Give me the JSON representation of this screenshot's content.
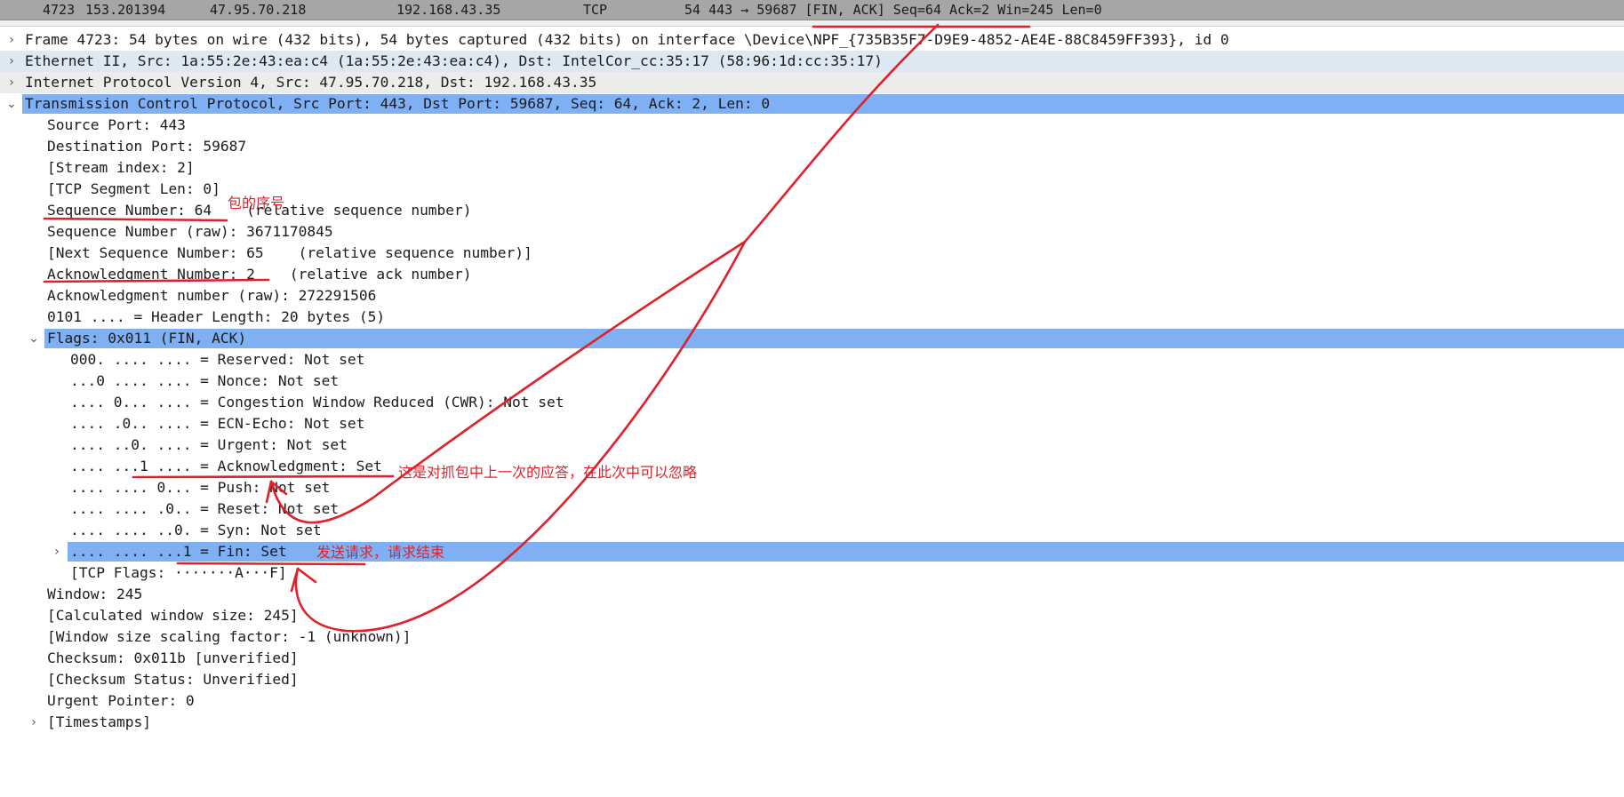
{
  "packet_row": {
    "no": "4723",
    "time": "153.201394",
    "source": "47.95.70.218",
    "destination": "192.168.43.35",
    "protocol": "TCP",
    "info": "54 443 → 59687 [FIN, ACK] Seq=64 Ack=2 Win=245 Len=0"
  },
  "details": [
    {
      "text": "Frame 4723: 54 bytes on wire (432 bits), 54 bytes captured (432 bits) on interface \\Device\\NPF_{735B35F7-D9E9-4852-AE4E-88C8459FF393}, id 0",
      "arrow": "›"
    },
    {
      "text": "Ethernet II, Src: 1a:55:2e:43:ea:c4 (1a:55:2e:43:ea:c4), Dst: IntelCor_cc:35:17 (58:96:1d:cc:35:17)",
      "arrow": "›"
    },
    {
      "text": "Internet Protocol Version 4, Src: 47.95.70.218, Dst: 192.168.43.35",
      "arrow": "›"
    },
    {
      "text": "Transmission Control Protocol, Src Port: 443, Dst Port: 59687, Seq: 64, Ack: 2, Len: 0",
      "arrow": "⌄"
    },
    {
      "text": "Source Port: 443"
    },
    {
      "text": "Destination Port: 59687"
    },
    {
      "text": "[Stream index: 2]"
    },
    {
      "text": "[TCP Segment Len: 0]"
    },
    {
      "text": "Sequence Number: 64    (relative sequence number)"
    },
    {
      "text": "Sequence Number (raw): 3671170845"
    },
    {
      "text": "[Next Sequence Number: 65    (relative sequence number)]"
    },
    {
      "text": "Acknowledgment Number: 2    (relative ack number)"
    },
    {
      "text": "Acknowledgment number (raw): 272291506"
    },
    {
      "text": "0101 .... = Header Length: 20 bytes (5)"
    },
    {
      "text": "Flags: 0x011 (FIN, ACK)",
      "arrow": "⌄"
    },
    {
      "text": "000. .... .... = Reserved: Not set"
    },
    {
      "text": "...0 .... .... = Nonce: Not set"
    },
    {
      "text": ".... 0... .... = Congestion Window Reduced (CWR): Not set"
    },
    {
      "text": ".... .0.. .... = ECN-Echo: Not set"
    },
    {
      "text": ".... ..0. .... = Urgent: Not set"
    },
    {
      "text": ".... ...1 .... = Acknowledgment: Set"
    },
    {
      "text": ".... .... 0... = Push: Not set"
    },
    {
      "text": ".... .... .0.. = Reset: Not set"
    },
    {
      "text": ".... .... ..0. = Syn: Not set"
    },
    {
      "text": ".... .... ...1 = Fin: Set",
      "arrow": "›"
    },
    {
      "text": "[TCP Flags: ·······A···F]"
    },
    {
      "text": "Window: 245"
    },
    {
      "text": "[Calculated window size: 245]"
    },
    {
      "text": "[Window size scaling factor: -1 (unknown)]"
    },
    {
      "text": "Checksum: 0x011b [unverified]"
    },
    {
      "text": "[Checksum Status: Unverified]"
    },
    {
      "text": "Urgent Pointer: 0"
    },
    {
      "text": "[Timestamps]",
      "arrow": "›"
    }
  ],
  "annotations": {
    "seq_note": "包的序号",
    "ack_note": "这是对抓包中上一次的应答，在此次中可以忽略",
    "fin_note": "发送请求，请求结束"
  },
  "colors": {
    "selection": "#7fb0f3",
    "annotation": "#e0202a",
    "packet_list_bg": "#a6a6a6"
  }
}
